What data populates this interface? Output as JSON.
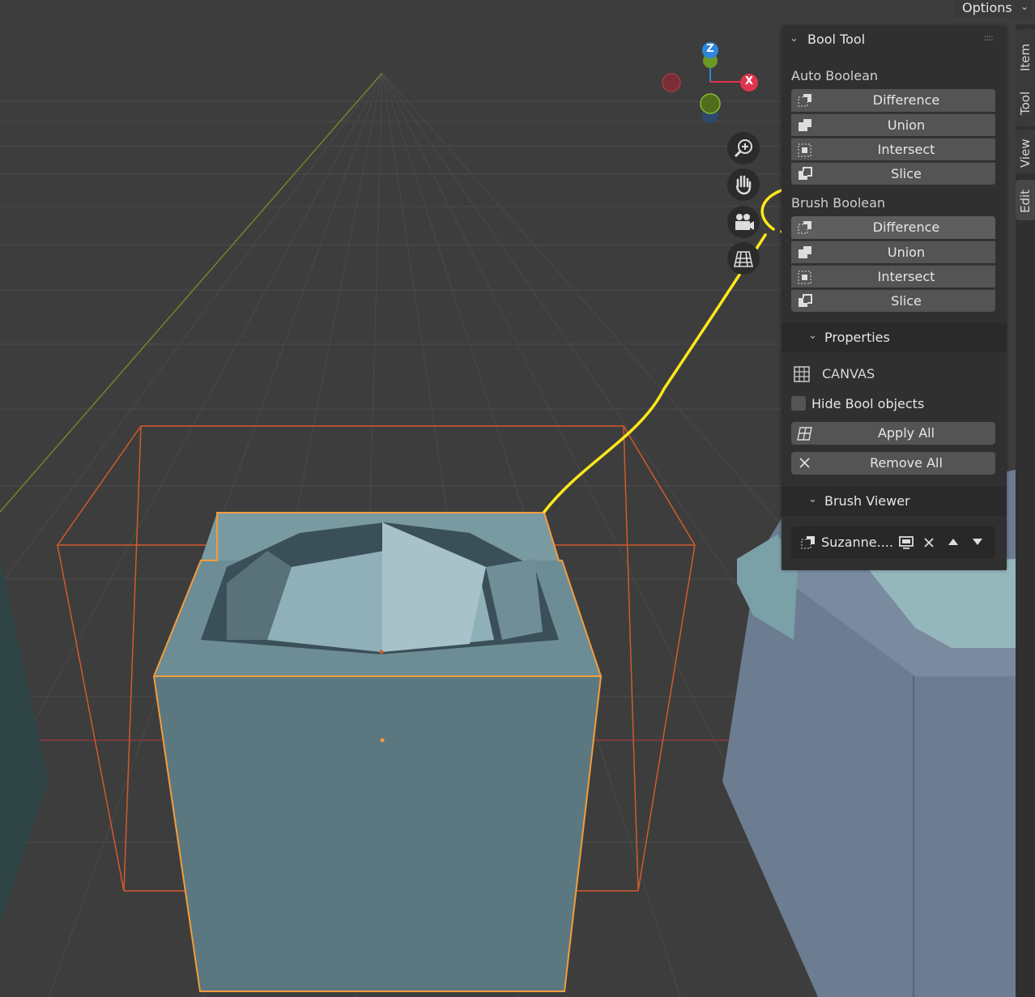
{
  "options": {
    "label": "Options"
  },
  "sidebar_tabs": [
    {
      "label": "Item"
    },
    {
      "label": "Tool"
    },
    {
      "label": "View"
    },
    {
      "label": "Edit"
    }
  ],
  "panel": {
    "title": "Bool Tool",
    "auto_boolean": {
      "heading": "Auto Boolean",
      "buttons": [
        {
          "label": "Difference",
          "icon": "difference-icon"
        },
        {
          "label": "Union",
          "icon": "union-icon"
        },
        {
          "label": "Intersect",
          "icon": "intersect-icon"
        },
        {
          "label": "Slice",
          "icon": "slice-icon"
        }
      ]
    },
    "brush_boolean": {
      "heading": "Brush Boolean",
      "buttons": [
        {
          "label": "Difference",
          "icon": "difference-icon"
        },
        {
          "label": "Union",
          "icon": "union-icon"
        },
        {
          "label": "Intersect",
          "icon": "intersect-icon"
        },
        {
          "label": "Slice",
          "icon": "slice-icon"
        }
      ]
    },
    "properties": {
      "title": "Properties",
      "canvas_label": "CANVAS",
      "hide_bool_label": "Hide Bool objects",
      "hide_bool_checked": false,
      "apply_all": "Apply All",
      "remove_all": "Remove All"
    },
    "brush_viewer": {
      "title": "Brush Viewer",
      "item_name": "Suzanne...."
    }
  },
  "gizmo": {
    "z": "Z",
    "x": "X"
  },
  "colors": {
    "viewport_bg": "#3d3d3d",
    "panel_bg": "#303030",
    "button_bg": "#545454",
    "selection_orange": "#f39c3c",
    "annotation_yellow": "#ffe81a",
    "axis_x": "#e0344e",
    "axis_y": "#6a9a24",
    "axis_z": "#2e86de"
  }
}
